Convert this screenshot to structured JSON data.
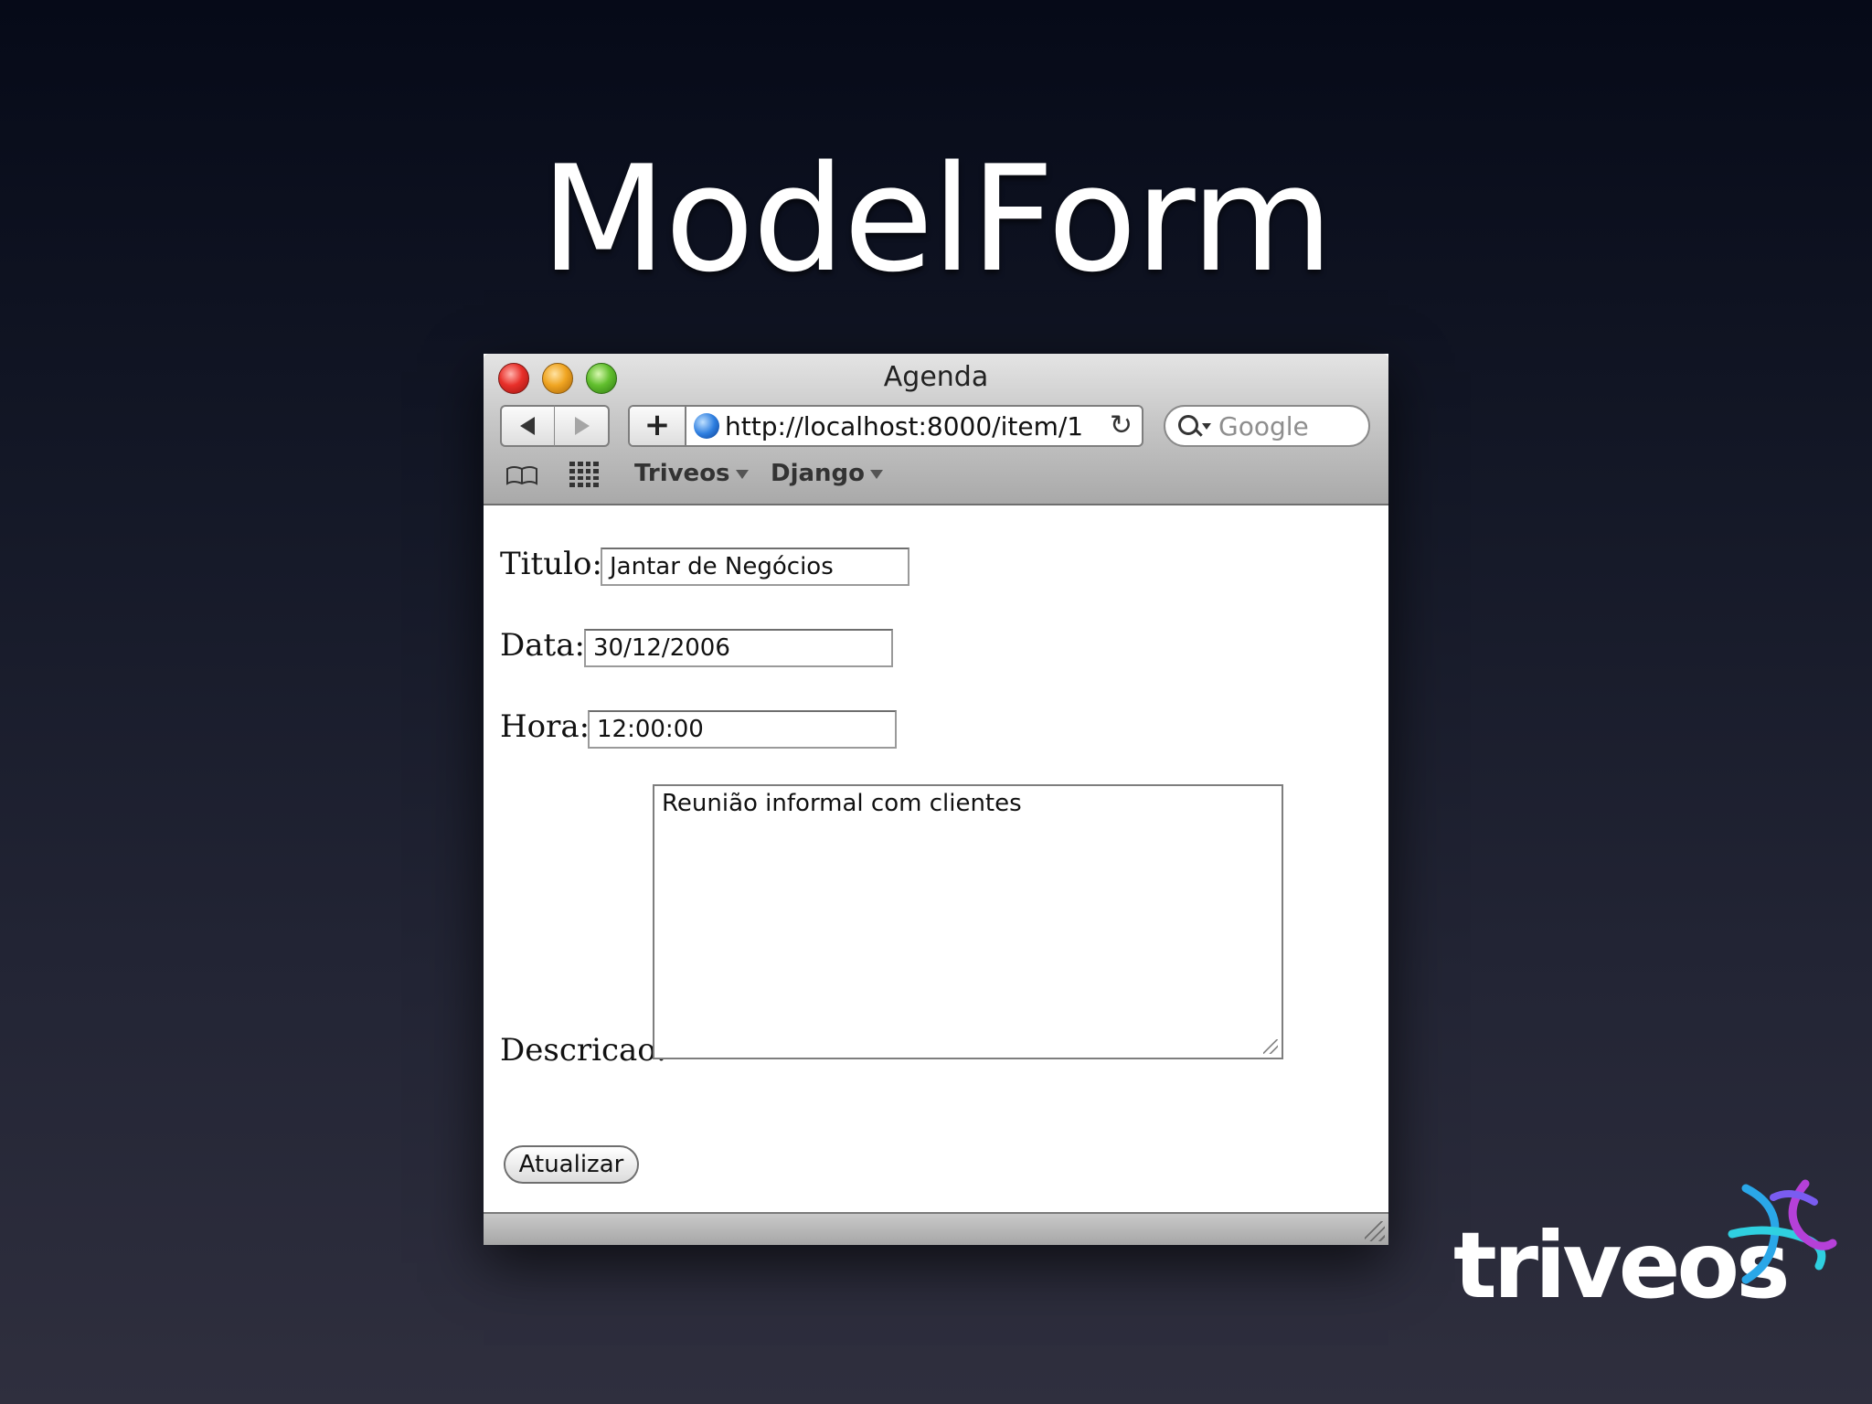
{
  "slide": {
    "title": "ModelForm"
  },
  "window": {
    "title": "Agenda",
    "url": "http://localhost:8000/item/1",
    "search_placeholder": "Google",
    "add_label": "+",
    "reload_glyph": "↻",
    "bookmarks": [
      {
        "label": "Triveos"
      },
      {
        "label": "Django"
      }
    ]
  },
  "form": {
    "titulo_label": "Titulo:",
    "titulo_value": "Jantar de Negócios",
    "data_label": "Data:",
    "data_value": "30/12/2006",
    "hora_label": "Hora:",
    "hora_value": "12:00:00",
    "descricao_label": "Descricao:",
    "descricao_value": "Reunião informal com clientes",
    "submit_label": "Atualizar"
  },
  "logo": {
    "text": "triveos"
  },
  "icons": [
    "close-icon",
    "minimize-icon",
    "zoom-icon",
    "back-arrow-icon",
    "forward-arrow-icon",
    "globe-icon",
    "reload-icon",
    "search-icon",
    "bookmarks-book-icon",
    "top-sites-grid-icon"
  ]
}
